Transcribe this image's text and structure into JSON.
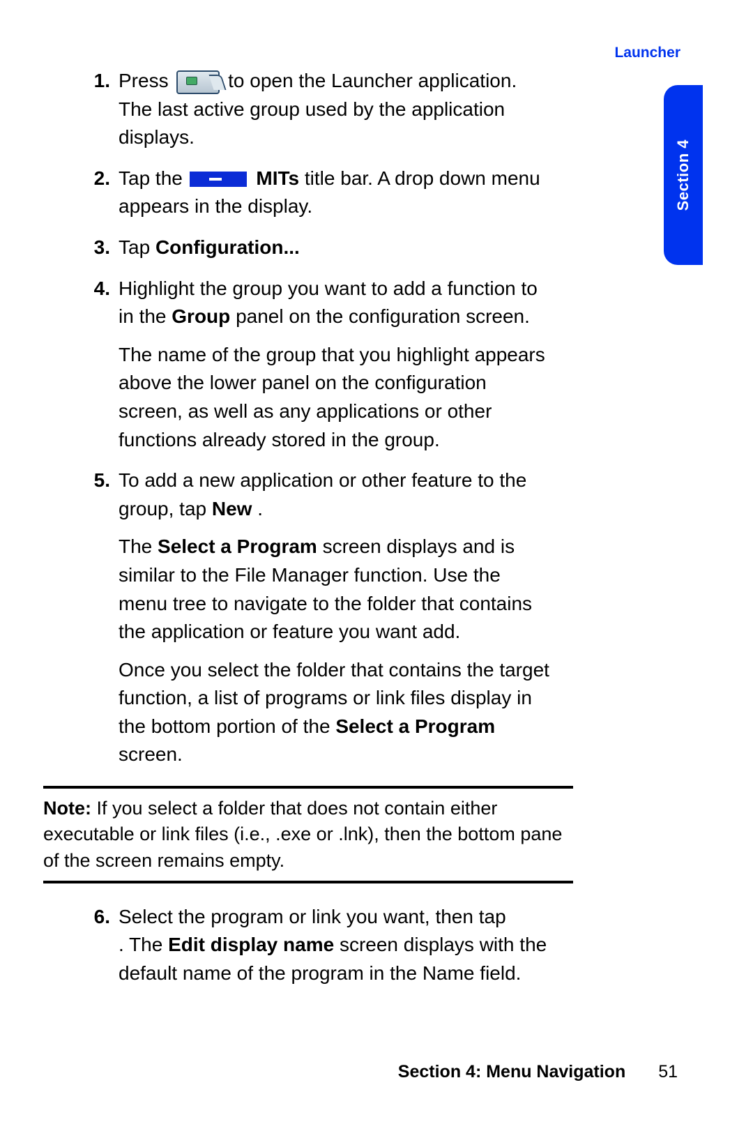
{
  "header": {
    "label": "Launcher"
  },
  "sidetab": {
    "label": "Section 4"
  },
  "steps": {
    "s1": {
      "num": "1.",
      "t1a": "Press ",
      "t1b": " to open the Launcher application. The last active group used by the application displays."
    },
    "s2": {
      "num": "2.",
      "t2a": "Tap the ",
      "mits": " MITs",
      "t2b": " title bar.  A drop down menu appears in the display."
    },
    "s3": {
      "num": "3.",
      "t3a": "Tap ",
      "conf": "Configuration..."
    },
    "s4": {
      "num": "4.",
      "p1a": "Highlight the group you want to add a function to in the ",
      "p1b": "Group",
      "p1c": " panel on the configuration screen.",
      "p2": "The name of the group that you highlight appears above the lower panel on the configuration screen, as well as any applications or other functions already stored in the group."
    },
    "s5": {
      "num": "5.",
      "p1a": "To add a new application or other feature to the group, tap ",
      "p1b": "New",
      "p1c": ".",
      "p2a": "The ",
      "p2b": "Select a Program",
      "p2c": " screen displays and is similar to the File Manager function. Use the menu tree to navigate to the folder that contains the application or feature you want add.",
      "p3a": "Once you select the folder that contains the target function, a list of programs or link files display in the bottom portion of the ",
      "p3b": "Select a Program",
      "p3c": " screen."
    },
    "s6": {
      "num": "6.",
      "p1a": "Select the program or link you want, then tap ",
      "p1gap": "      ",
      "p1b": ". The ",
      "p1c": "Edit display name",
      "p1d": " screen displays with the default name of the program in the Name field."
    }
  },
  "note": {
    "label": "Note: ",
    "text": "If you select a folder that does not contain either executable or link files (i.e., .exe or .lnk), then the bottom pane of the screen remains empty."
  },
  "footer": {
    "section": "Section 4: Menu Navigation",
    "page": "51"
  }
}
